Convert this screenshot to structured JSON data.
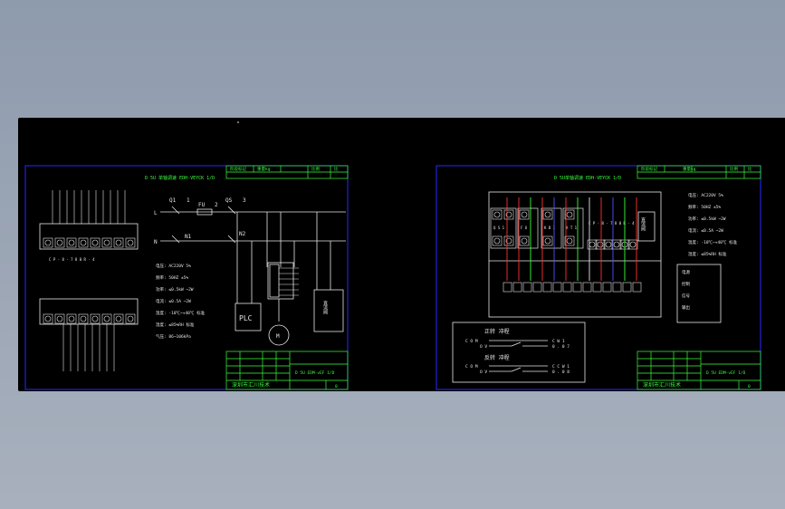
{
  "sheet_left": {
    "title": "D 5U 单轴调速 EDH-VEYCK 1/D",
    "labels": {
      "l": "L",
      "n": "N",
      "n1": "N1",
      "n2": "N2",
      "q1": "Q1",
      "fu": "FU",
      "qs": "QS",
      "num1": "1",
      "num2": "2",
      "num3": "3",
      "plc": "PLC",
      "motor": "M",
      "box": "直流阀",
      "module": "C P - 8 - 7 8 0 R - 4"
    },
    "specs": [
      "电压: AC220V 5%",
      "频率: 50HZ  ±5%",
      "功率: ≤0.5kW  ~2W",
      "电流: ≤0.5A   ~2W",
      "温度: -10℃~+40℃ 标准",
      "湿度: ≤85%RH 标准",
      "气压: 86~106kPa"
    ],
    "title_block": {
      "top": [
        "阶段标记",
        "重量kg",
        "比例",
        "比"
      ],
      "caption": "D 5U EDM-vEF 1/D",
      "company": "深圳市汇川技术",
      "sheet": "0"
    }
  },
  "sheet_right": {
    "title": "D 5U单轴调速 EDH-VEYCK 1/D",
    "relays": [
      "Q S 1",
      "F U",
      "K B 1",
      "K T 1"
    ],
    "module": "C P - 8 - 7 8 0 R - 4",
    "box": "直流阀",
    "specs": [
      "电压: AC220V 5%",
      "频率: 50HZ  ±5%",
      "功率: ≤0.5kW  ~2W",
      "电流: ≤0.5A   ~2W",
      "温度: -10℃~+40℃ 标准",
      "湿度: ≤85%RH 标准"
    ],
    "legend": {
      "forward": "正转 冲程",
      "reverse": "反转 冲程",
      "com1": "C O M",
      "ov1": "O V",
      "cw": "C W 1",
      "a1": "0 . 0 7",
      "com2": "C O M",
      "ov2": "O V",
      "ccw": "C C W 1",
      "a2": "0 . 0 8"
    },
    "side_box": [
      "电源",
      "控制",
      "信号",
      "输出"
    ],
    "title_block": {
      "top": [
        "阶段标记",
        "重量kg",
        "比例",
        "比"
      ],
      "caption": "D 5U EDM-vEF 1/D",
      "company": "深圳市汇川技术",
      "sheet": "0"
    }
  }
}
